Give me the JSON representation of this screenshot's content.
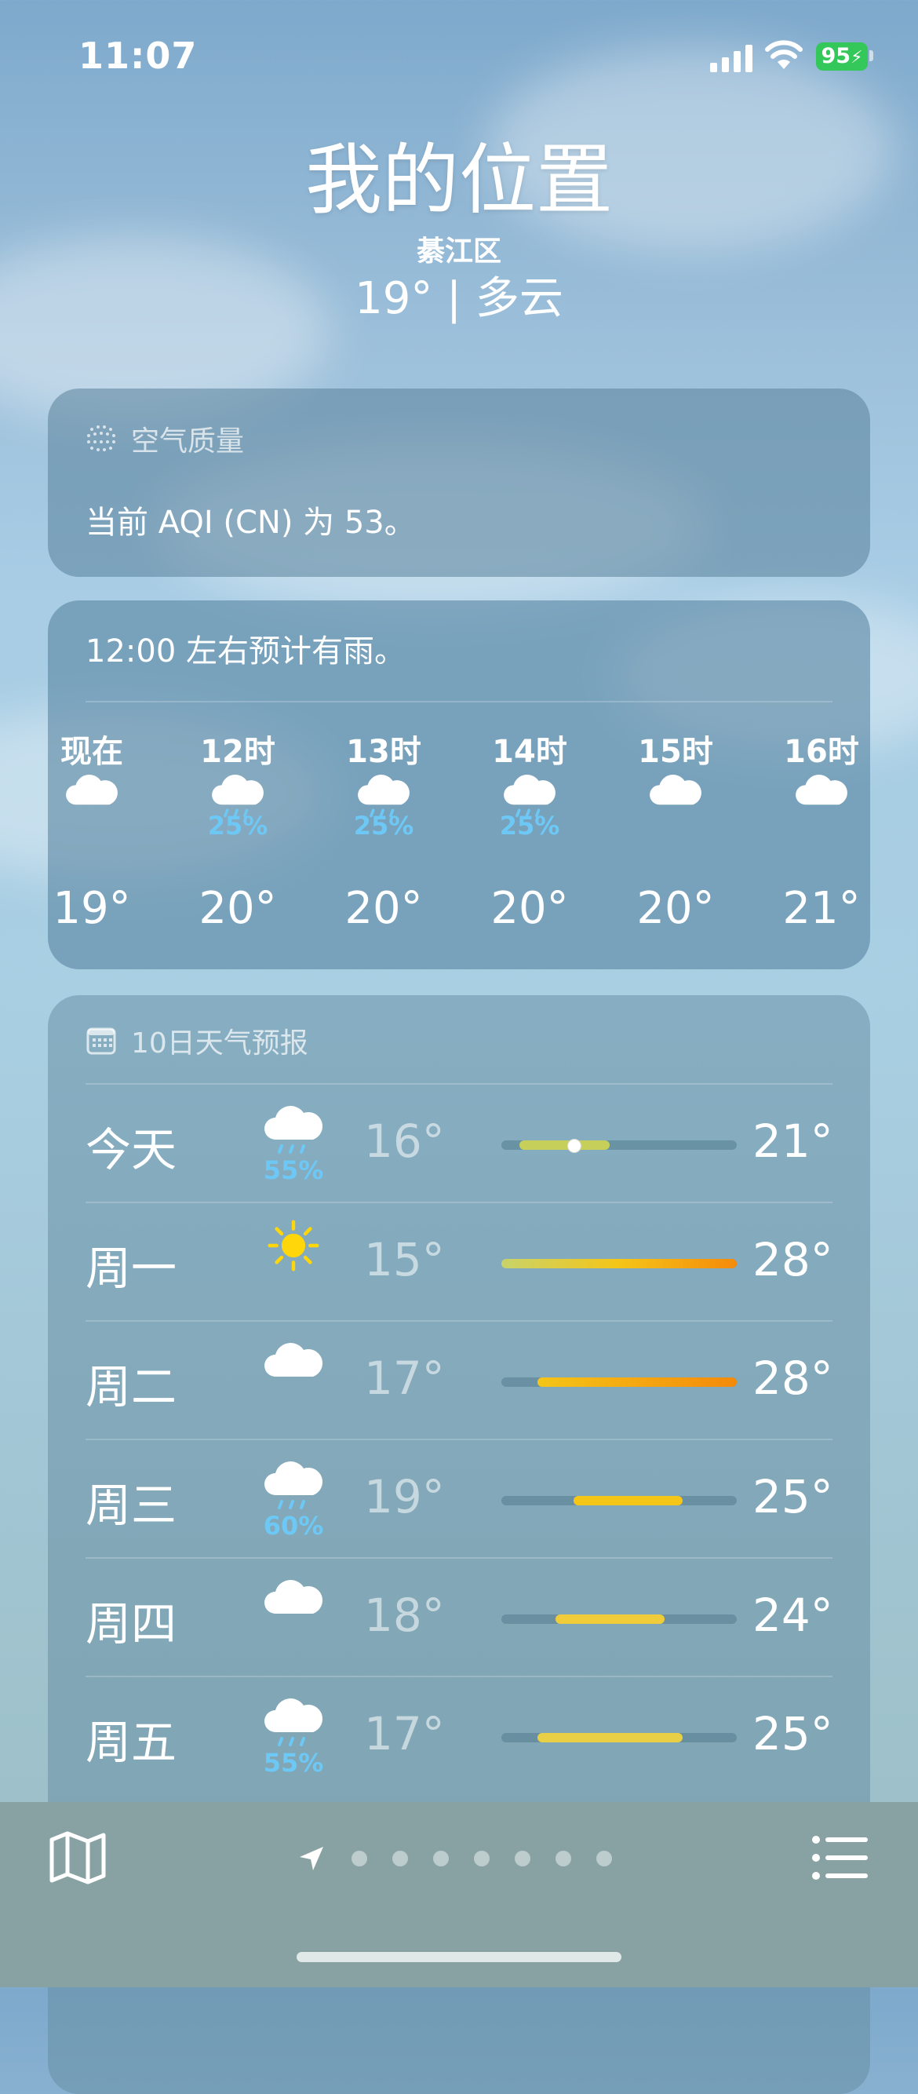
{
  "status_bar": {
    "time": "11:07",
    "battery": "95"
  },
  "header": {
    "title": "我的位置",
    "district": "綦江区",
    "temp_condition": "19° | 多云"
  },
  "aqi_card": {
    "title": "空气质量",
    "text": "当前 AQI (CN) 为 53。"
  },
  "hourly": {
    "summary": "12:00 左右预计有雨。",
    "hours": [
      {
        "label": "现在",
        "icon": "cloud-icon",
        "pop": "",
        "temp": "19°"
      },
      {
        "label": "12时",
        "icon": "cloud-rain-icon",
        "pop": "25%",
        "temp": "20°"
      },
      {
        "label": "13时",
        "icon": "cloud-rain-icon",
        "pop": "25%",
        "temp": "20°"
      },
      {
        "label": "14时",
        "icon": "cloud-rain-icon",
        "pop": "25%",
        "temp": "20°"
      },
      {
        "label": "15时",
        "icon": "cloud-icon",
        "pop": "",
        "temp": "20°"
      },
      {
        "label": "16时",
        "icon": "cloud-icon",
        "pop": "",
        "temp": "21°"
      }
    ]
  },
  "daily": {
    "title": "10日天气预报",
    "range_min": 15,
    "range_max": 28,
    "days": [
      {
        "name": "今天",
        "icon": "cloud-rain-icon",
        "pop": "55%",
        "low": "16°",
        "high": "21°",
        "low_val": 16,
        "high_val": 21,
        "current_val": 19,
        "color": "#c5cf5a"
      },
      {
        "name": "周一",
        "icon": "sun-icon",
        "pop": "",
        "low": "15°",
        "high": "28°",
        "low_val": 15,
        "high_val": 28,
        "color": "#f5a623"
      },
      {
        "name": "周二",
        "icon": "cloud-icon",
        "pop": "",
        "low": "17°",
        "high": "28°",
        "low_val": 17,
        "high_val": 28,
        "color": "#f5a623"
      },
      {
        "name": "周三",
        "icon": "cloud-rain-icon",
        "pop": "60%",
        "low": "19°",
        "high": "25°",
        "low_val": 19,
        "high_val": 25,
        "color": "#f5c518"
      },
      {
        "name": "周四",
        "icon": "cloud-icon",
        "pop": "",
        "low": "18°",
        "high": "24°",
        "low_val": 18,
        "high_val": 24,
        "color": "#f1cc3a"
      },
      {
        "name": "周五",
        "icon": "cloud-rain-icon",
        "pop": "55%",
        "low": "17°",
        "high": "25°",
        "low_val": 17,
        "high_val": 25,
        "color": "#e8cf45"
      }
    ]
  },
  "colors": {
    "precip": "#6ec8f5",
    "battery": "#34c759",
    "sun": "#ffd60a"
  },
  "page_indicator": {
    "count": 7,
    "current": 0
  }
}
